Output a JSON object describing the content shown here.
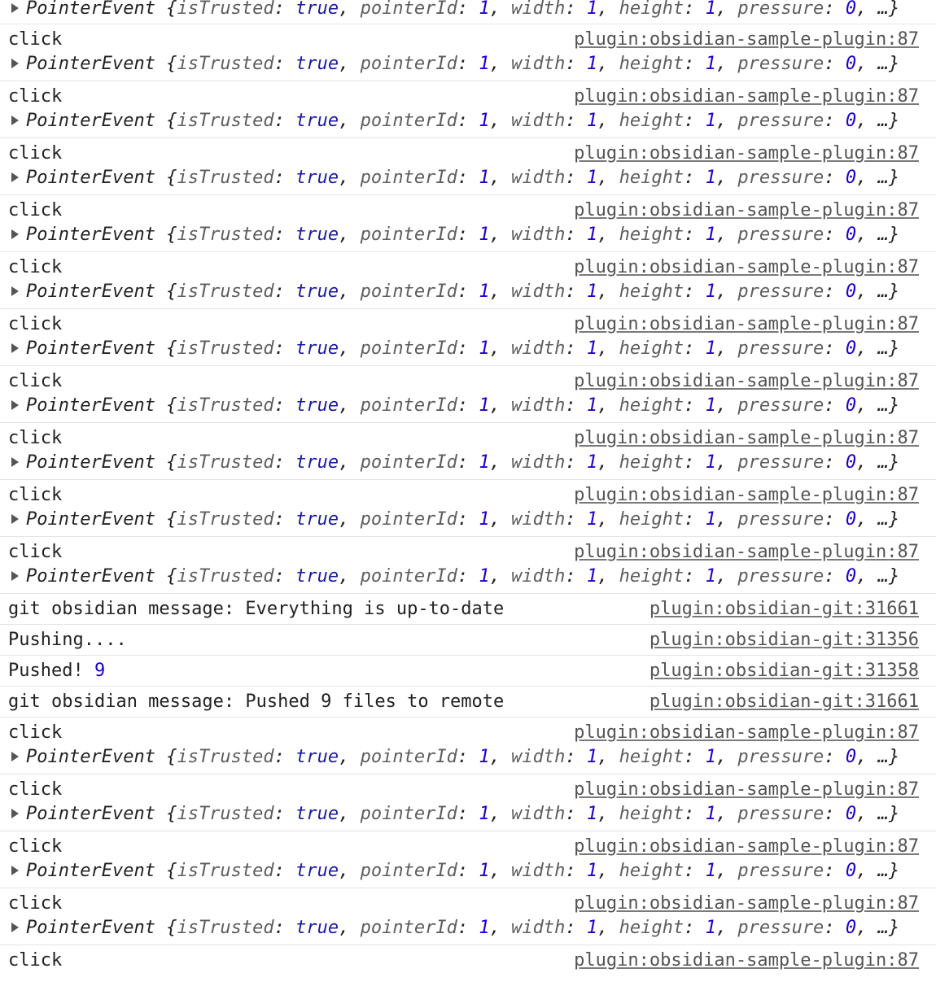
{
  "colors": {
    "background": "#ffffff",
    "text": "#222222",
    "keyword": "#1a1aa6",
    "number": "#1c00cf",
    "key": "#5e5e5e",
    "link": "#545454",
    "divider": "#e4e4e4"
  },
  "icons": {
    "expand": "triangle-right-icon"
  },
  "object_preview": {
    "class_name": "PointerEvent",
    "open": "{",
    "props": [
      {
        "key": "isTrusted",
        "value": "true",
        "kind": "keyword"
      },
      {
        "key": "pointerId",
        "value": "1",
        "kind": "number"
      },
      {
        "key": "width",
        "value": "1",
        "kind": "number"
      },
      {
        "key": "height",
        "value": "1",
        "kind": "number"
      },
      {
        "key": "pressure",
        "value": "0",
        "kind": "number"
      }
    ],
    "ellipsis": "…",
    "close": "}"
  },
  "entries": [
    {
      "type": "object_only"
    },
    {
      "type": "click",
      "message": "click",
      "source": "plugin:obsidian-sample-plugin:87"
    },
    {
      "type": "click",
      "message": "click",
      "source": "plugin:obsidian-sample-plugin:87"
    },
    {
      "type": "click",
      "message": "click",
      "source": "plugin:obsidian-sample-plugin:87"
    },
    {
      "type": "click",
      "message": "click",
      "source": "plugin:obsidian-sample-plugin:87"
    },
    {
      "type": "click",
      "message": "click",
      "source": "plugin:obsidian-sample-plugin:87"
    },
    {
      "type": "click",
      "message": "click",
      "source": "plugin:obsidian-sample-plugin:87"
    },
    {
      "type": "click",
      "message": "click",
      "source": "plugin:obsidian-sample-plugin:87"
    },
    {
      "type": "click",
      "message": "click",
      "source": "plugin:obsidian-sample-plugin:87"
    },
    {
      "type": "click",
      "message": "click",
      "source": "plugin:obsidian-sample-plugin:87"
    },
    {
      "type": "click",
      "message": "click",
      "source": "plugin:obsidian-sample-plugin:87"
    },
    {
      "type": "message",
      "message": "git obsidian message: Everything is up-to-date",
      "source": "plugin:obsidian-git:31661"
    },
    {
      "type": "message",
      "message": "Pushing....",
      "source": "plugin:obsidian-git:31356"
    },
    {
      "type": "message",
      "message": "Pushed!",
      "number": "9",
      "source": "plugin:obsidian-git:31358"
    },
    {
      "type": "message",
      "message": "git obsidian message: Pushed 9 files to remote",
      "source": "plugin:obsidian-git:31661"
    },
    {
      "type": "click",
      "message": "click",
      "source": "plugin:obsidian-sample-plugin:87"
    },
    {
      "type": "click",
      "message": "click",
      "source": "plugin:obsidian-sample-plugin:87"
    },
    {
      "type": "click",
      "message": "click",
      "source": "plugin:obsidian-sample-plugin:87"
    },
    {
      "type": "click",
      "message": "click",
      "source": "plugin:obsidian-sample-plugin:87"
    },
    {
      "type": "click_partial",
      "message": "click",
      "source": "plugin:obsidian-sample-plugin:87"
    }
  ]
}
